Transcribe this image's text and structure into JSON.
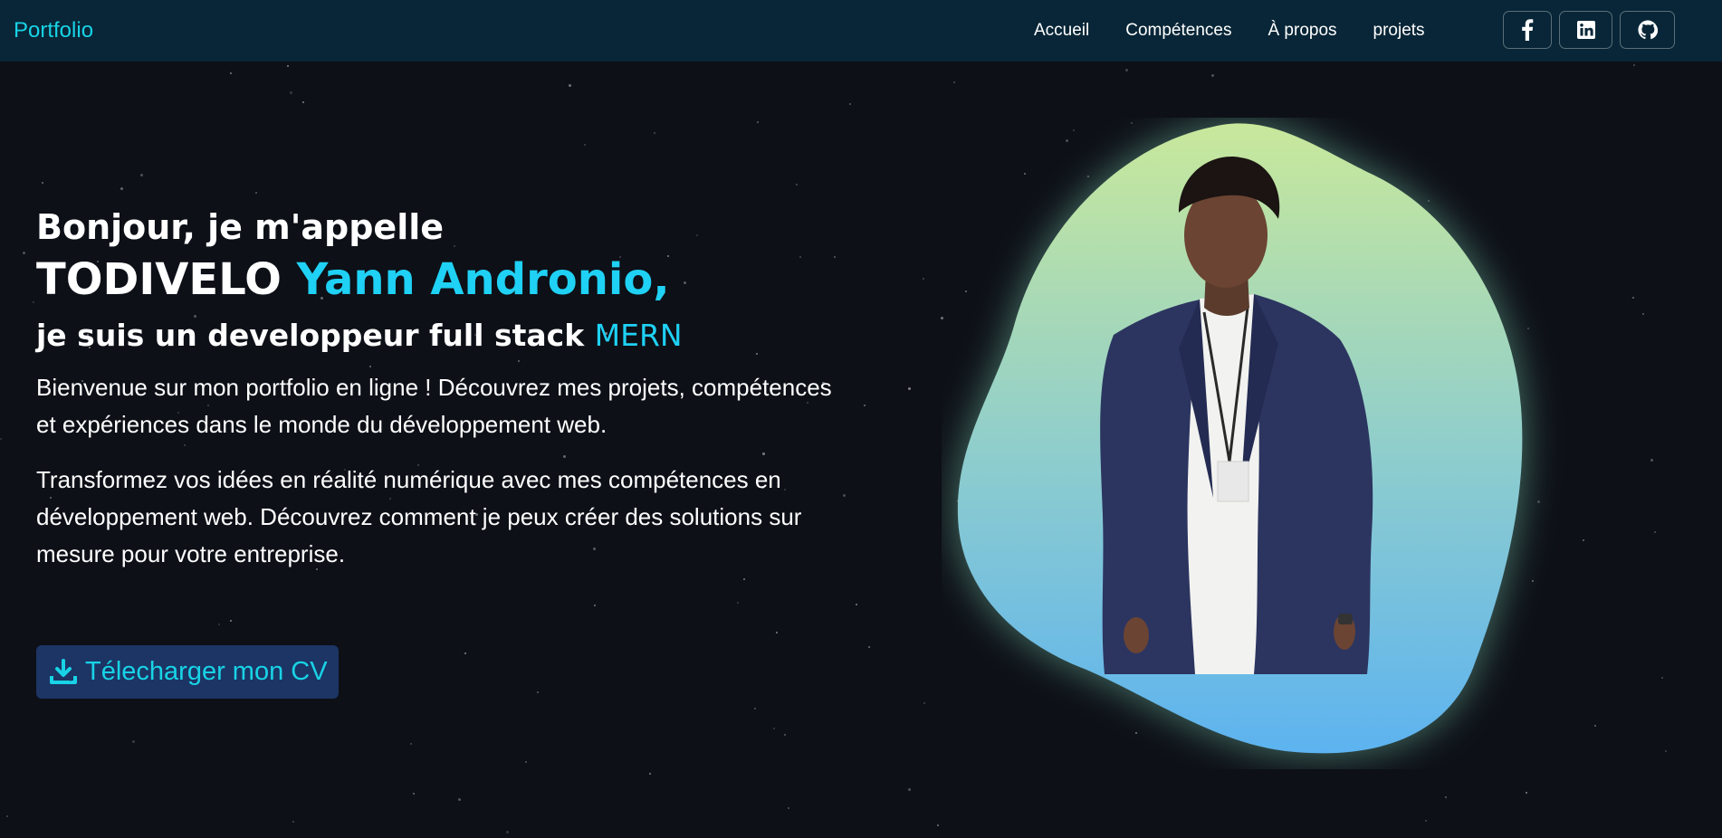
{
  "navbar": {
    "brand": "Portfolio",
    "links": [
      "Accueil",
      "Compétences",
      "À propos",
      "projets"
    ],
    "socials": [
      "facebook-icon",
      "linkedin-icon",
      "github-icon"
    ]
  },
  "hero": {
    "greeting": "Bonjour, je m'appelle",
    "name_last": "TODIVELO",
    "name_first": "Yann Andronio,",
    "role_prefix": "je suis un developpeur full stack",
    "role_stack": "MERN",
    "paragraph_1": "Bienvenue sur mon portfolio en ligne ! Découvrez mes projets, compétences et expériences dans le monde du développement web.",
    "paragraph_2": "Transformez vos idées en réalité numérique avec mes compétences en développement web. Découvrez comment je peux créer des solutions sur mesure pour votre entreprise.",
    "cv_button": "Télecharger mon CV"
  },
  "colors": {
    "accent": "#1fd1f4",
    "navbar_bg": "#082637",
    "page_bg": "#0d1017",
    "cv_button_bg": "#1c3564",
    "blob_top": "#c8e89b",
    "blob_bottom": "#5db3f0"
  }
}
